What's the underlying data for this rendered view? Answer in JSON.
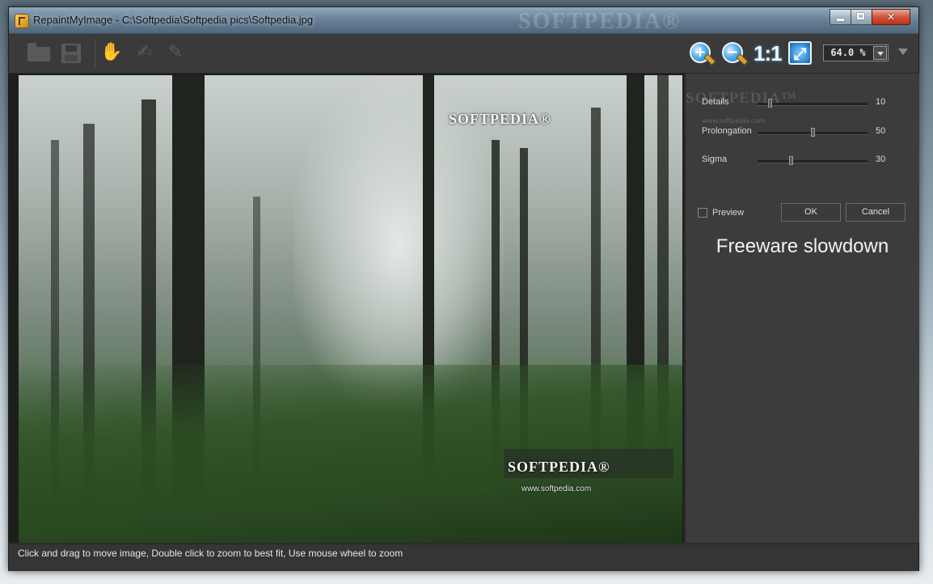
{
  "window": {
    "title": "RepaintMyImage - C:\\Softpedia\\Softpedia pics\\Softpedia.jpg",
    "controls": {
      "minimize": "minimize",
      "maximize": "maximize",
      "close": "✕"
    }
  },
  "toolbar": {
    "buttons": [
      "open-icon",
      "save-icon",
      "paint-brush-icon",
      "brush-stroke-icon",
      "pen-brush-icon"
    ],
    "zoom_in": "+",
    "zoom_out": "−",
    "one_to_one": "1:1",
    "zoom_value": "64.0 %"
  },
  "canvas": {
    "watermark_top": "SOFTPEDIA®",
    "watermark_bottom": "SOFTPEDIA®",
    "watermark_url": "www.softpedia.com"
  },
  "panel": {
    "watermark": "SOFTPEDIA™",
    "watermark_url": "www.softpedia.com",
    "sliders": [
      {
        "label": "Details",
        "value": "10",
        "level": 0.1
      },
      {
        "label": "Prolongation",
        "value": "50",
        "level": 0.5
      },
      {
        "label": "Sigma",
        "value": "30",
        "level": 0.3
      }
    ],
    "preview_label": "Preview",
    "preview_checked": false,
    "ok_label": "OK",
    "cancel_label": "Cancel",
    "notice": "Freeware slowdown"
  },
  "status": {
    "text": "Click and drag to move image, Double click to zoom to best fit, Use mouse wheel to zoom"
  },
  "colors": {
    "window_bg": "#2f2f2f",
    "panel_bg": "#3c3c3c",
    "accent_blue": "#3a90d8"
  }
}
